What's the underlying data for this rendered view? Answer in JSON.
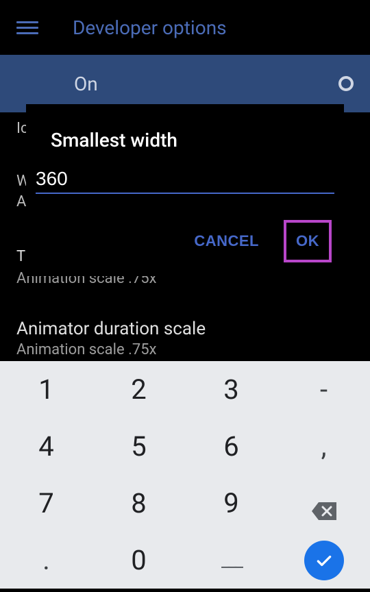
{
  "appbar": {
    "title": "Developer options"
  },
  "toggle": {
    "label": "On"
  },
  "background": {
    "partial_ic": "Ic",
    "partial_w": "W",
    "partial_a": "A",
    "partial_t": "T",
    "anim_scale_line1": "Animation scale .75x",
    "animator_title": "Animator duration scale",
    "anim_scale_line2": "Animation scale .75x"
  },
  "dialog": {
    "title": "Smallest width",
    "value": "360",
    "cancel": "CANCEL",
    "ok": "OK"
  },
  "keyboard": {
    "keys": [
      "1",
      "2",
      "3",
      "-",
      "4",
      "5",
      "6",
      ",",
      "7",
      "8",
      "9",
      "",
      " . ",
      "0",
      "___",
      ""
    ]
  }
}
